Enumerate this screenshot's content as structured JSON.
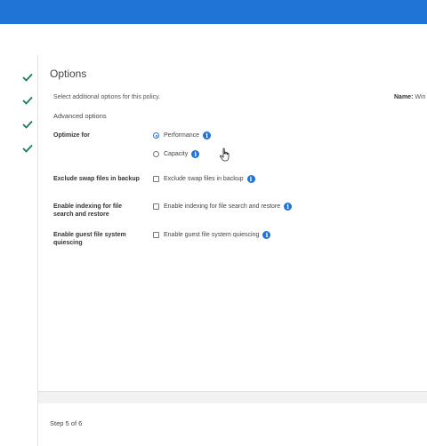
{
  "header": {
    "bar_color": "#1f74d6"
  },
  "steps": {
    "completed_count": 4,
    "check_color": "#1b7a5a"
  },
  "page": {
    "title": "Options",
    "subtitle": "Select additional options for this policy.",
    "name_label": "Name:",
    "name_value": "Win"
  },
  "advanced": {
    "section_title": "Advanced options",
    "optimize": {
      "label": "Optimize for",
      "options": [
        {
          "label": "Performance",
          "selected": true
        },
        {
          "label": "Capacity",
          "selected": false
        }
      ]
    },
    "swap": {
      "label": "Exclude swap files in backup",
      "option": "Exclude swap files in backup",
      "checked": false
    },
    "indexing": {
      "label": "Enable indexing for file search and restore",
      "option": "Enable indexing for file search and restore",
      "checked": false
    },
    "quiescing": {
      "label": "Enable guest file system quiescing",
      "option": "Enable guest file system quiescing",
      "checked": false
    }
  },
  "footer": {
    "step_text": "Step 5 of 6"
  },
  "icons": {
    "info": "info-icon",
    "check": "check-icon",
    "cursor": "hand-pointer-icon"
  }
}
